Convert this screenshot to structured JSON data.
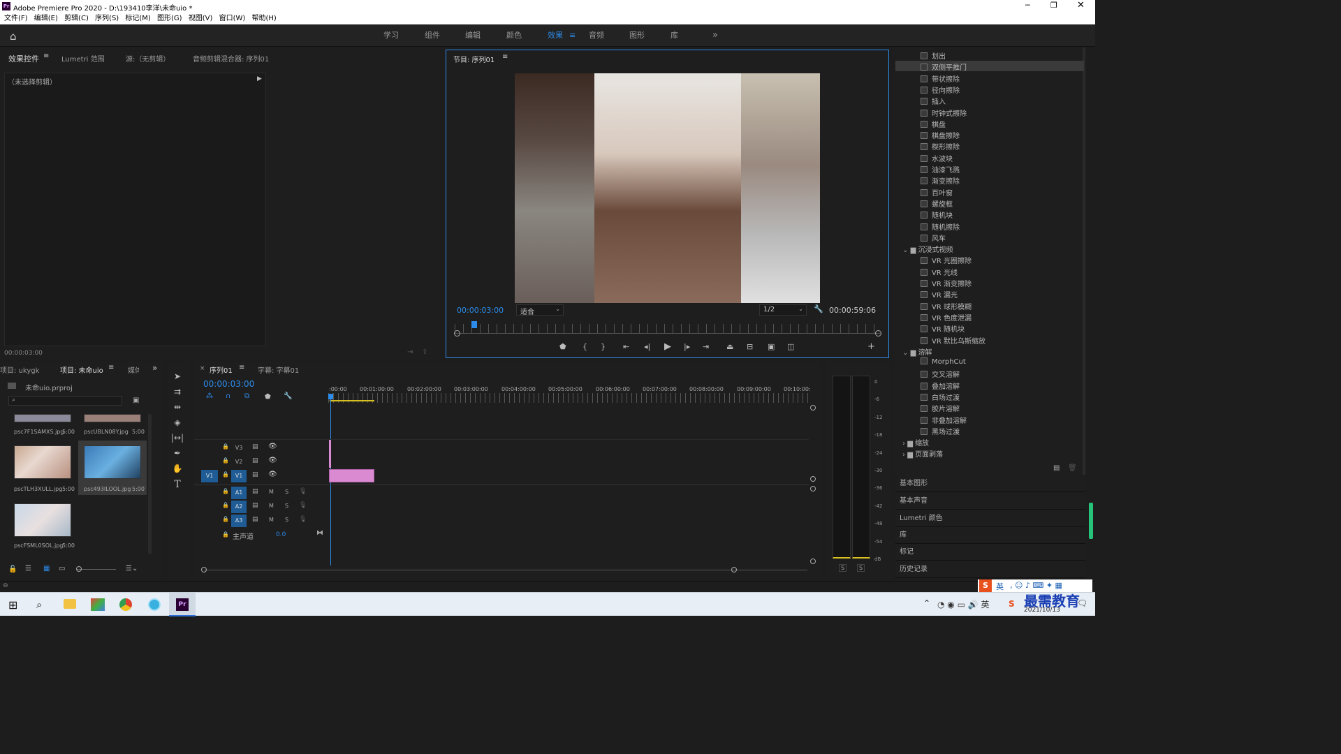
{
  "app": {
    "title": "Adobe Premiere Pro 2020 - D:\\193410李洋\\未命uio *"
  },
  "menu": [
    "文件(F)",
    "编辑(E)",
    "剪辑(C)",
    "序列(S)",
    "标记(M)",
    "图形(G)",
    "视图(V)",
    "窗口(W)",
    "帮助(H)"
  ],
  "workspaces": [
    "学习",
    "组件",
    "编辑",
    "颜色",
    "效果",
    "音频",
    "图形",
    "库"
  ],
  "active_workspace": "效果",
  "source_panel": {
    "tabs": [
      "效果控件",
      "Lumetri 范围",
      "源:（无剪辑）",
      "音频剪辑混合器: 序列01"
    ],
    "no_clip": "（未选择剪辑）",
    "timecode": "00:00:03:00"
  },
  "program": {
    "tab": "节目: 序列01",
    "timecode": "00:00:03:00",
    "fit": "适合",
    "resolution": "1/2",
    "duration": "00:00:59:06"
  },
  "project": {
    "tabs": [
      "项目: ukygk",
      "项目: 未命uio",
      "媒体"
    ],
    "file": "未命uio.prproj",
    "items": [
      {
        "name": "psc7F1SAMXS.jpg",
        "dur": "5:00"
      },
      {
        "name": "pscUBLN08Y.jpg",
        "dur": "5:00"
      },
      {
        "name": "pscTLH3XULL.jpg",
        "dur": "5:00"
      },
      {
        "name": "psc493ILOOL.jpg",
        "dur": "5:00"
      },
      {
        "name": "pscFSML0SOL.jpg",
        "dur": "5:00"
      }
    ]
  },
  "timeline": {
    "tabs": [
      "序列01",
      "字幕: 字幕01"
    ],
    "timecode": "00:00:03:00",
    "ruler": [
      ":00:00",
      "00:01:00:00",
      "00:02:00:00",
      "00:03:00:00",
      "00:04:00:00",
      "00:05:00:00",
      "00:06:00:00",
      "00:07:00:00",
      "00:08:00:00",
      "00:09:00:00",
      "00:10:00:"
    ],
    "video_tracks": [
      "V3",
      "V2",
      "V1"
    ],
    "audio_tracks": [
      "A1",
      "A2",
      "A3"
    ],
    "source_patch": "V1",
    "master": "主声道",
    "master_val": "0.0",
    "mute": "M",
    "solo": "S"
  },
  "meter": {
    "scale": [
      "0",
      "-6",
      "-12",
      "-18",
      "-24",
      "-30",
      "-36",
      "-42",
      "-48",
      "-54",
      "dB"
    ],
    "solo": [
      "S",
      "S"
    ]
  },
  "effects": {
    "items": [
      "划出",
      "双侧平推门",
      "带状擦除",
      "径向擦除",
      "插入",
      "时钟式擦除",
      "棋盘",
      "棋盘擦除",
      "楔形擦除",
      "水波块",
      "油漆飞溅",
      "渐变擦除",
      "百叶窗",
      "螺旋框",
      "随机块",
      "随机擦除",
      "风车"
    ],
    "folder_immersive": "沉浸式视频",
    "immersive": [
      "VR 光圈擦除",
      "VR 光线",
      "VR 渐变擦除",
      "VR 漏光",
      "VR 球形模糊",
      "VR 色度泄漏",
      "VR 随机块",
      "VR 默比乌斯缩放"
    ],
    "folder_dissolve": "溶解",
    "dissolve": [
      "MorphCut",
      "交叉溶解",
      "叠加溶解",
      "白场过渡",
      "胶片溶解",
      "非叠加溶解",
      "黑场过渡"
    ],
    "folder_zoom": "缩放",
    "folder_page": "页面剥落"
  },
  "right_panels": [
    "基本图形",
    "基本声音",
    "Lumetri 颜色",
    "库",
    "标记",
    "历史记录"
  ],
  "tray": {
    "ime": "英",
    "date": "2021/10/13",
    "watermark": "最需教育"
  },
  "colors": {
    "accent": "#2d8ceb",
    "clip": "#d98ad0",
    "panel": "#1e1e1e"
  }
}
